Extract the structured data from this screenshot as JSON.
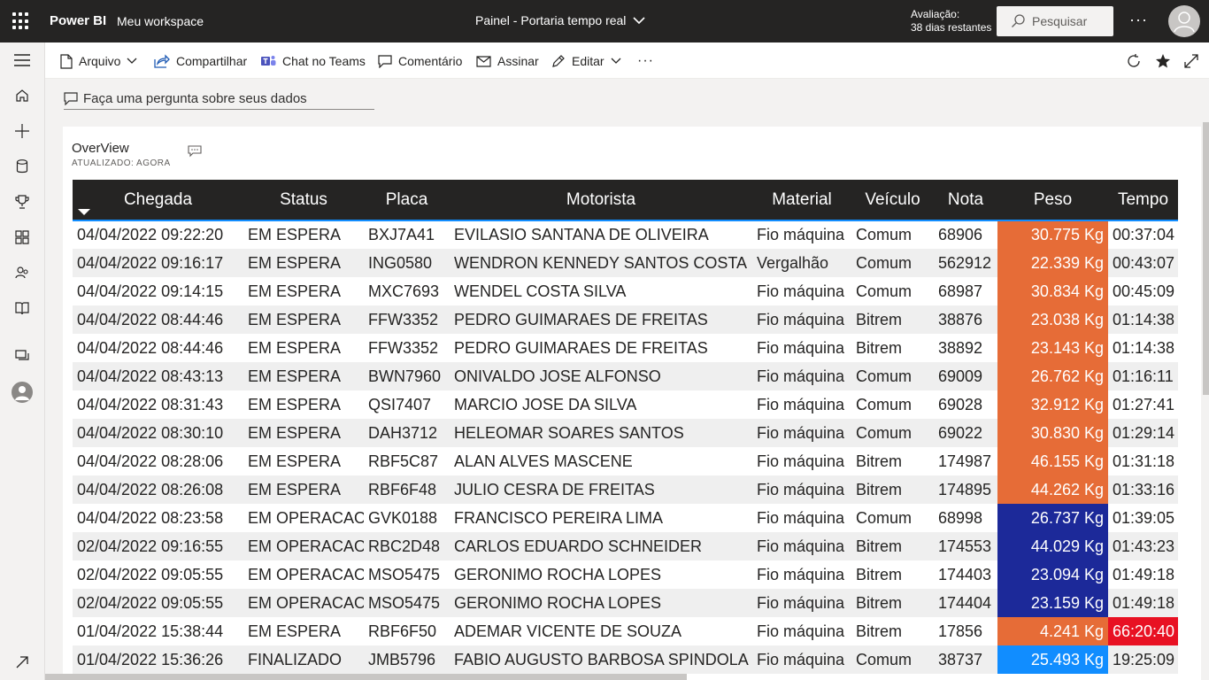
{
  "topbar": {
    "brand": "Power BI",
    "workspace": "Meu workspace",
    "report_title": "Painel - Portaria tempo real",
    "trial_line1": "Avaliação:",
    "trial_line2": "38 dias restantes",
    "search_placeholder": "Pesquisar"
  },
  "actionbar": {
    "arquivo": "Arquivo",
    "compartilhar": "Compartilhar",
    "chat_teams": "Chat no Teams",
    "comentario": "Comentário",
    "assinar": "Assinar",
    "editar": "Editar"
  },
  "qa": {
    "placeholder": "Faça uma pergunta sobre seus dados"
  },
  "visual": {
    "title": "OverView",
    "updated": "ATUALIZADO: AGORA"
  },
  "table": {
    "headers": {
      "chegada": "Chegada",
      "status": "Status",
      "placa": "Placa",
      "motorista": "Motorista",
      "material": "Material",
      "veiculo": "Veículo",
      "nota": "Nota",
      "peso": "Peso",
      "tempo": "Tempo"
    },
    "rows": [
      {
        "chegada": "04/04/2022 09:22:20",
        "status": "EM ESPERA",
        "placa": "BXJ7A41",
        "motorista": "EVILASIO SANTANA DE OLIVEIRA",
        "material": "Fio máquina",
        "veiculo": "Comum",
        "nota": "68906",
        "peso": "30.775 Kg",
        "tempo": "00:37:04",
        "peso_color": "orange",
        "tempo_alert": false
      },
      {
        "chegada": "04/04/2022 09:16:17",
        "status": "EM ESPERA",
        "placa": "ING0580",
        "motorista": "WENDRON KENNEDY SANTOS COSTA",
        "material": "Vergalhão",
        "veiculo": "Comum",
        "nota": "562912",
        "peso": "22.339 Kg",
        "tempo": "00:43:07",
        "peso_color": "orange",
        "tempo_alert": false
      },
      {
        "chegada": "04/04/2022 09:14:15",
        "status": "EM ESPERA",
        "placa": "MXC7693",
        "motorista": "WENDEL COSTA SILVA",
        "material": "Fio máquina",
        "veiculo": "Comum",
        "nota": "68987",
        "peso": "30.834 Kg",
        "tempo": "00:45:09",
        "peso_color": "orange",
        "tempo_alert": false
      },
      {
        "chegada": "04/04/2022 08:44:46",
        "status": "EM ESPERA",
        "placa": "FFW3352",
        "motorista": "PEDRO GUIMARAES DE FREITAS",
        "material": "Fio máquina",
        "veiculo": "Bitrem",
        "nota": "38876",
        "peso": "23.038 Kg",
        "tempo": "01:14:38",
        "peso_color": "orange",
        "tempo_alert": false
      },
      {
        "chegada": "04/04/2022 08:44:46",
        "status": "EM ESPERA",
        "placa": "FFW3352",
        "motorista": "PEDRO GUIMARAES DE FREITAS",
        "material": "Fio máquina",
        "veiculo": "Bitrem",
        "nota": "38892",
        "peso": "23.143 Kg",
        "tempo": "01:14:38",
        "peso_color": "orange",
        "tempo_alert": false
      },
      {
        "chegada": "04/04/2022 08:43:13",
        "status": "EM ESPERA",
        "placa": "BWN7960",
        "motorista": "ONIVALDO JOSE ALFONSO",
        "material": "Fio máquina",
        "veiculo": "Comum",
        "nota": "69009",
        "peso": "26.762 Kg",
        "tempo": "01:16:11",
        "peso_color": "orange",
        "tempo_alert": false
      },
      {
        "chegada": "04/04/2022 08:31:43",
        "status": "EM ESPERA",
        "placa": "QSI7407",
        "motorista": "MARCIO JOSE DA SILVA",
        "material": "Fio máquina",
        "veiculo": "Comum",
        "nota": "69028",
        "peso": "32.912 Kg",
        "tempo": "01:27:41",
        "peso_color": "orange",
        "tempo_alert": false
      },
      {
        "chegada": "04/04/2022 08:30:10",
        "status": "EM ESPERA",
        "placa": "DAH3712",
        "motorista": "HELEOMAR SOARES SANTOS",
        "material": "Fio máquina",
        "veiculo": "Comum",
        "nota": "69022",
        "peso": "30.830 Kg",
        "tempo": "01:29:14",
        "peso_color": "orange",
        "tempo_alert": false
      },
      {
        "chegada": "04/04/2022 08:28:06",
        "status": "EM ESPERA",
        "placa": "RBF5C87",
        "motorista": "ALAN ALVES MASCENE",
        "material": "Fio máquina",
        "veiculo": "Bitrem",
        "nota": "174987",
        "peso": "46.155 Kg",
        "tempo": "01:31:18",
        "peso_color": "orange",
        "tempo_alert": false
      },
      {
        "chegada": "04/04/2022 08:26:08",
        "status": "EM ESPERA",
        "placa": "RBF6F48",
        "motorista": "JULIO CESRA DE FREITAS",
        "material": "Fio máquina",
        "veiculo": "Bitrem",
        "nota": "174895",
        "peso": "44.262 Kg",
        "tempo": "01:33:16",
        "peso_color": "orange",
        "tempo_alert": false
      },
      {
        "chegada": "04/04/2022 08:23:58",
        "status": "EM OPERACAO",
        "placa": "GVK0188",
        "motorista": "FRANCISCO PEREIRA LIMA",
        "material": "Fio máquina",
        "veiculo": "Comum",
        "nota": "68998",
        "peso": "26.737 Kg",
        "tempo": "01:39:05",
        "peso_color": "navy",
        "tempo_alert": false
      },
      {
        "chegada": "02/04/2022 09:16:55",
        "status": "EM OPERACAO",
        "placa": "RBC2D48",
        "motorista": "CARLOS EDUARDO SCHNEIDER",
        "material": "Fio máquina",
        "veiculo": "Bitrem",
        "nota": "174553",
        "peso": "44.029 Kg",
        "tempo": "01:43:23",
        "peso_color": "navy",
        "tempo_alert": false
      },
      {
        "chegada": "02/04/2022 09:05:55",
        "status": "EM OPERACAO",
        "placa": "MSO5475",
        "motorista": "GERONIMO ROCHA LOPES",
        "material": "Fio máquina",
        "veiculo": "Bitrem",
        "nota": "174403",
        "peso": "23.094 Kg",
        "tempo": "01:49:18",
        "peso_color": "navy",
        "tempo_alert": false
      },
      {
        "chegada": "02/04/2022 09:05:55",
        "status": "EM OPERACAO",
        "placa": "MSO5475",
        "motorista": "GERONIMO ROCHA LOPES",
        "material": "Fio máquina",
        "veiculo": "Bitrem",
        "nota": "174404",
        "peso": "23.159 Kg",
        "tempo": "01:49:18",
        "peso_color": "navy",
        "tempo_alert": false
      },
      {
        "chegada": "01/04/2022 15:38:44",
        "status": "EM ESPERA",
        "placa": "RBF6F50",
        "motorista": "ADEMAR VICENTE DE SOUZA",
        "material": "Fio máquina",
        "veiculo": "Bitrem",
        "nota": "17856",
        "peso": "4.241 Kg",
        "tempo": "66:20:40",
        "peso_color": "orange",
        "tempo_alert": true
      },
      {
        "chegada": "01/04/2022 15:36:26",
        "status": "FINALIZADO",
        "placa": "JMB5796",
        "motorista": "FABIO AUGUSTO BARBOSA SPINDOLA",
        "material": "Fio máquina",
        "veiculo": "Comum",
        "nota": "38737",
        "peso": "25.493 Kg",
        "tempo": "19:25:09",
        "peso_color": "sky",
        "tempo_alert": false
      }
    ]
  }
}
